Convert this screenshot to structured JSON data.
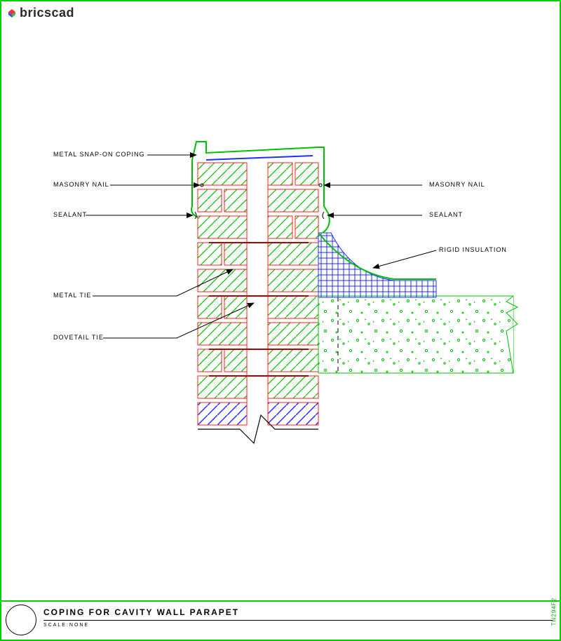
{
  "header": {
    "brand": "bricscad"
  },
  "labels": {
    "left": [
      {
        "id": "metal-snap-on-coping",
        "text": "METAL SNAP-ON COPING"
      },
      {
        "id": "masonry-nail-left",
        "text": "MASONRY NAIL"
      },
      {
        "id": "sealant-left",
        "text": "SEALANT"
      },
      {
        "id": "metal-tie",
        "text": "METAL TIE"
      },
      {
        "id": "dovetail-tie",
        "text": "DOVETAIL TIE"
      }
    ],
    "right": [
      {
        "id": "masonry-nail-right",
        "text": "MASONRY NAIL"
      },
      {
        "id": "sealant-right",
        "text": "SEALANT"
      },
      {
        "id": "rigid-insulation",
        "text": "RIGID INSULATION"
      }
    ]
  },
  "titleblock": {
    "title": "COPING FOR CAVITY WALL PARAPET",
    "scale": "SCALE:NONE",
    "code": "TN294F2"
  }
}
